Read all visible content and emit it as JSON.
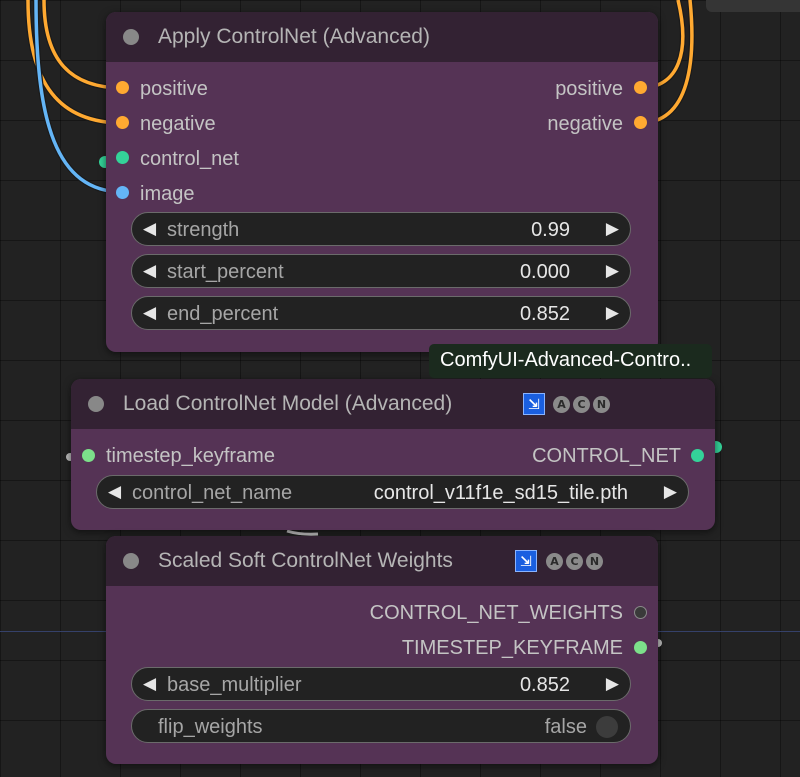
{
  "colors": {
    "canvas": "#222222",
    "node_body": "#553355",
    "node_title": "#332233",
    "conditioning": "#ffa931",
    "control_net": "#34d399",
    "image": "#64b5f6",
    "timestep_keyframe": "#7ce08a",
    "weights": "#8a8a8a",
    "badge": "#1a5fe0"
  },
  "tooltip": "ComfyUI-Advanced-Contro..",
  "nodes": [
    {
      "title": "Apply ControlNet (Advanced)",
      "inputs": [
        {
          "name": "positive",
          "color": "#ffa931"
        },
        {
          "name": "negative",
          "color": "#ffa931"
        },
        {
          "name": "control_net",
          "color": "#34d399"
        },
        {
          "name": "image",
          "color": "#64b5f6"
        }
      ],
      "outputs": [
        {
          "name": "positive",
          "color": "#ffa931"
        },
        {
          "name": "negative",
          "color": "#ffa931"
        }
      ],
      "widgets": [
        {
          "name": "strength",
          "value": "0.99"
        },
        {
          "name": "start_percent",
          "value": "0.000"
        },
        {
          "name": "end_percent",
          "value": "0.852"
        }
      ]
    },
    {
      "title": "Load ControlNet Model (Advanced)",
      "badges": [
        "A",
        "C",
        "N"
      ],
      "badge_icon": "puzzle-icon",
      "inputs": [
        {
          "name": "timestep_keyframe",
          "color": "#7ce08a"
        }
      ],
      "outputs": [
        {
          "name": "CONTROL_NET",
          "color": "#34d399"
        }
      ],
      "widgets": [
        {
          "name": "control_net_name",
          "value": "control_v11f1e_sd15_tile.pth"
        }
      ]
    },
    {
      "title": "Scaled Soft ControlNet Weights",
      "badges": [
        "A",
        "C",
        "N"
      ],
      "badge_icon": "puzzle-icon",
      "outputs": [
        {
          "name": "CONTROL_NET_WEIGHTS",
          "color": "#8a8a8a"
        },
        {
          "name": "TIMESTEP_KEYFRAME",
          "color": "#7ce08a"
        }
      ],
      "widgets": [
        {
          "name": "base_multiplier",
          "value": "0.852"
        }
      ],
      "toggle": {
        "name": "flip_weights",
        "value": "false"
      }
    }
  ]
}
